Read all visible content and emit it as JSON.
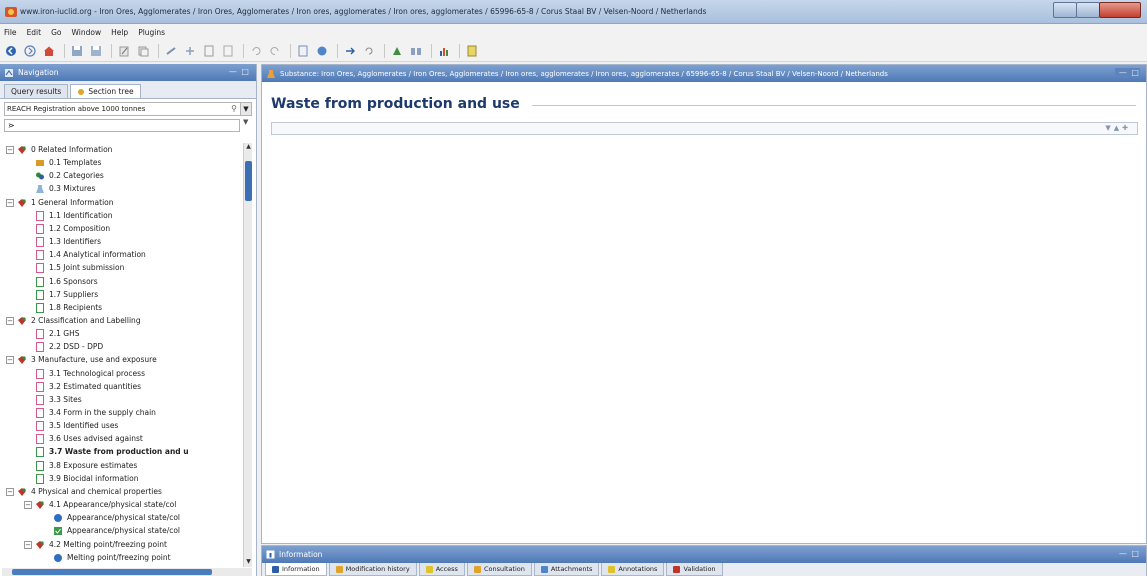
{
  "window": {
    "title": "www.iron-iuclid.org - Iron Ores, Agglomerates / Iron Ores, Agglomerates / Iron ores, agglomerates  / Iron ores, agglomerates  / 65996-65-8 / Corus Staal BV / Velsen-Noord / Netherlands"
  },
  "menu": [
    "File",
    "Edit",
    "Go",
    "Window",
    "Help",
    "Plugins"
  ],
  "navigation": {
    "title": "Navigation",
    "tabs": [
      "Query results",
      "Section tree"
    ],
    "combo_value": "REACH Registration above 1000 tonnes",
    "filter_value": "⋗"
  },
  "tree": [
    {
      "label": "0 Related Information",
      "level": 0,
      "icon": "red-folder-icon",
      "expanded": true
    },
    {
      "label": "0.1 Templates",
      "level": 1,
      "icon": "template-icon"
    },
    {
      "label": "0.2 Categories",
      "level": 1,
      "icon": "category-icon"
    },
    {
      "label": "0.3 Mixtures",
      "level": 1,
      "icon": "mixture-icon"
    },
    {
      "label": "1 General Information",
      "level": 0,
      "icon": "red-folder-icon",
      "expanded": true
    },
    {
      "label": "1.1 Identification",
      "level": 1,
      "icon": "document-red-icon"
    },
    {
      "label": "1.2 Composition",
      "level": 1,
      "icon": "document-red-icon"
    },
    {
      "label": "1.3 Identifiers",
      "level": 1,
      "icon": "document-red-icon"
    },
    {
      "label": "1.4 Analytical information",
      "level": 1,
      "icon": "document-red-icon"
    },
    {
      "label": "1.5 Joint submission",
      "level": 1,
      "icon": "document-red-icon"
    },
    {
      "label": "1.6 Sponsors",
      "level": 1,
      "icon": "document-green-icon"
    },
    {
      "label": "1.7 Suppliers",
      "level": 1,
      "icon": "document-green-icon"
    },
    {
      "label": "1.8 Recipients",
      "level": 1,
      "icon": "document-green-icon"
    },
    {
      "label": "2 Classification and Labelling",
      "level": 0,
      "icon": "red-folder-icon",
      "expanded": true
    },
    {
      "label": "2.1 GHS",
      "level": 1,
      "icon": "document-red-icon"
    },
    {
      "label": "2.2 DSD - DPD",
      "level": 1,
      "icon": "document-red-icon"
    },
    {
      "label": "3 Manufacture, use and exposure",
      "level": 0,
      "icon": "red-folder-icon",
      "expanded": true
    },
    {
      "label": "3.1 Technological process",
      "level": 1,
      "icon": "document-red-icon"
    },
    {
      "label": "3.2 Estimated quantities",
      "level": 1,
      "icon": "document-red-icon"
    },
    {
      "label": "3.3 Sites",
      "level": 1,
      "icon": "document-red-icon"
    },
    {
      "label": "3.4 Form in the supply chain",
      "level": 1,
      "icon": "document-red-icon"
    },
    {
      "label": "3.5 Identified uses",
      "level": 1,
      "icon": "document-red-icon"
    },
    {
      "label": "3.6 Uses advised against",
      "level": 1,
      "icon": "document-red-icon"
    },
    {
      "label": "3.7 Waste from production and u",
      "level": 1,
      "icon": "document-green-icon",
      "bold": true
    },
    {
      "label": "3.8 Exposure estimates",
      "level": 1,
      "icon": "document-green-icon"
    },
    {
      "label": "3.9 Biocidal information",
      "level": 1,
      "icon": "document-green-icon"
    },
    {
      "label": "4 Physical and chemical properties",
      "level": 0,
      "icon": "red-folder-icon",
      "expanded": true
    },
    {
      "label": "4.1 Appearance/physical state/col",
      "level": 1,
      "icon": "red-folder-icon",
      "expanded": true
    },
    {
      "label": "Appearance/physical state/col",
      "level": 2,
      "icon": "record-blue-icon"
    },
    {
      "label": "Appearance/physical state/col",
      "level": 2,
      "icon": "record-check-icon"
    },
    {
      "label": "4.2 Melting point/freezing point",
      "level": 1,
      "icon": "red-folder-icon",
      "expanded": true
    },
    {
      "label": "Melting point/freezing point",
      "level": 2,
      "icon": "record-blue-icon"
    }
  ],
  "editor": {
    "header": "Substance: Iron Ores, Agglomerates / Iron Ores, Agglomerates / Iron ores, agglomerates  / Iron ores, agglomerates  / 65996-65-8 / Corus Staal BV / Velsen-Noord / Netherlands",
    "section_title": "Waste from production and use"
  },
  "info_panel": {
    "title": "Information",
    "tabs": [
      "Information",
      "Modification history",
      "Access",
      "Consultation",
      "Attachments",
      "Annotations",
      "Validation"
    ]
  },
  "colors": {
    "panel_header": "#4f79b6",
    "section_title": "#1e3a6c",
    "tree_red": "#c0342b",
    "tree_green": "#2f8a3a"
  }
}
